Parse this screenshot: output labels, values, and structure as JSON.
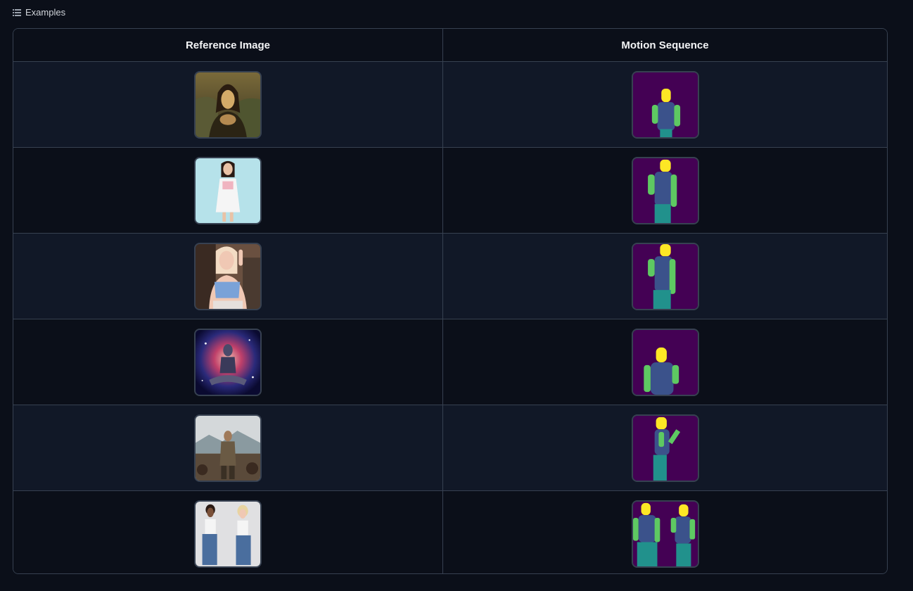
{
  "header": {
    "title": "Examples",
    "icon": "list-icon"
  },
  "table": {
    "columns": [
      "Reference Image",
      "Motion Sequence"
    ],
    "rows": [
      {
        "reference": "mona-lisa",
        "motion": "motion-1"
      },
      {
        "reference": "woman-white-dress",
        "motion": "motion-2"
      },
      {
        "reference": "blonde-woman-selfie",
        "motion": "motion-3"
      },
      {
        "reference": "cosmic-meditation",
        "motion": "motion-4"
      },
      {
        "reference": "man-mountains",
        "motion": "motion-5"
      },
      {
        "reference": "two-women-dancing",
        "motion": "motion-6"
      }
    ]
  },
  "colors": {
    "background": "#0b0f19",
    "row_alt": "#111827",
    "border": "#374151",
    "motion_bg": "#440154",
    "motion_head": "#fde725",
    "motion_limb": "#5ec962",
    "motion_torso": "#3b528b",
    "motion_leg": "#21918c"
  }
}
